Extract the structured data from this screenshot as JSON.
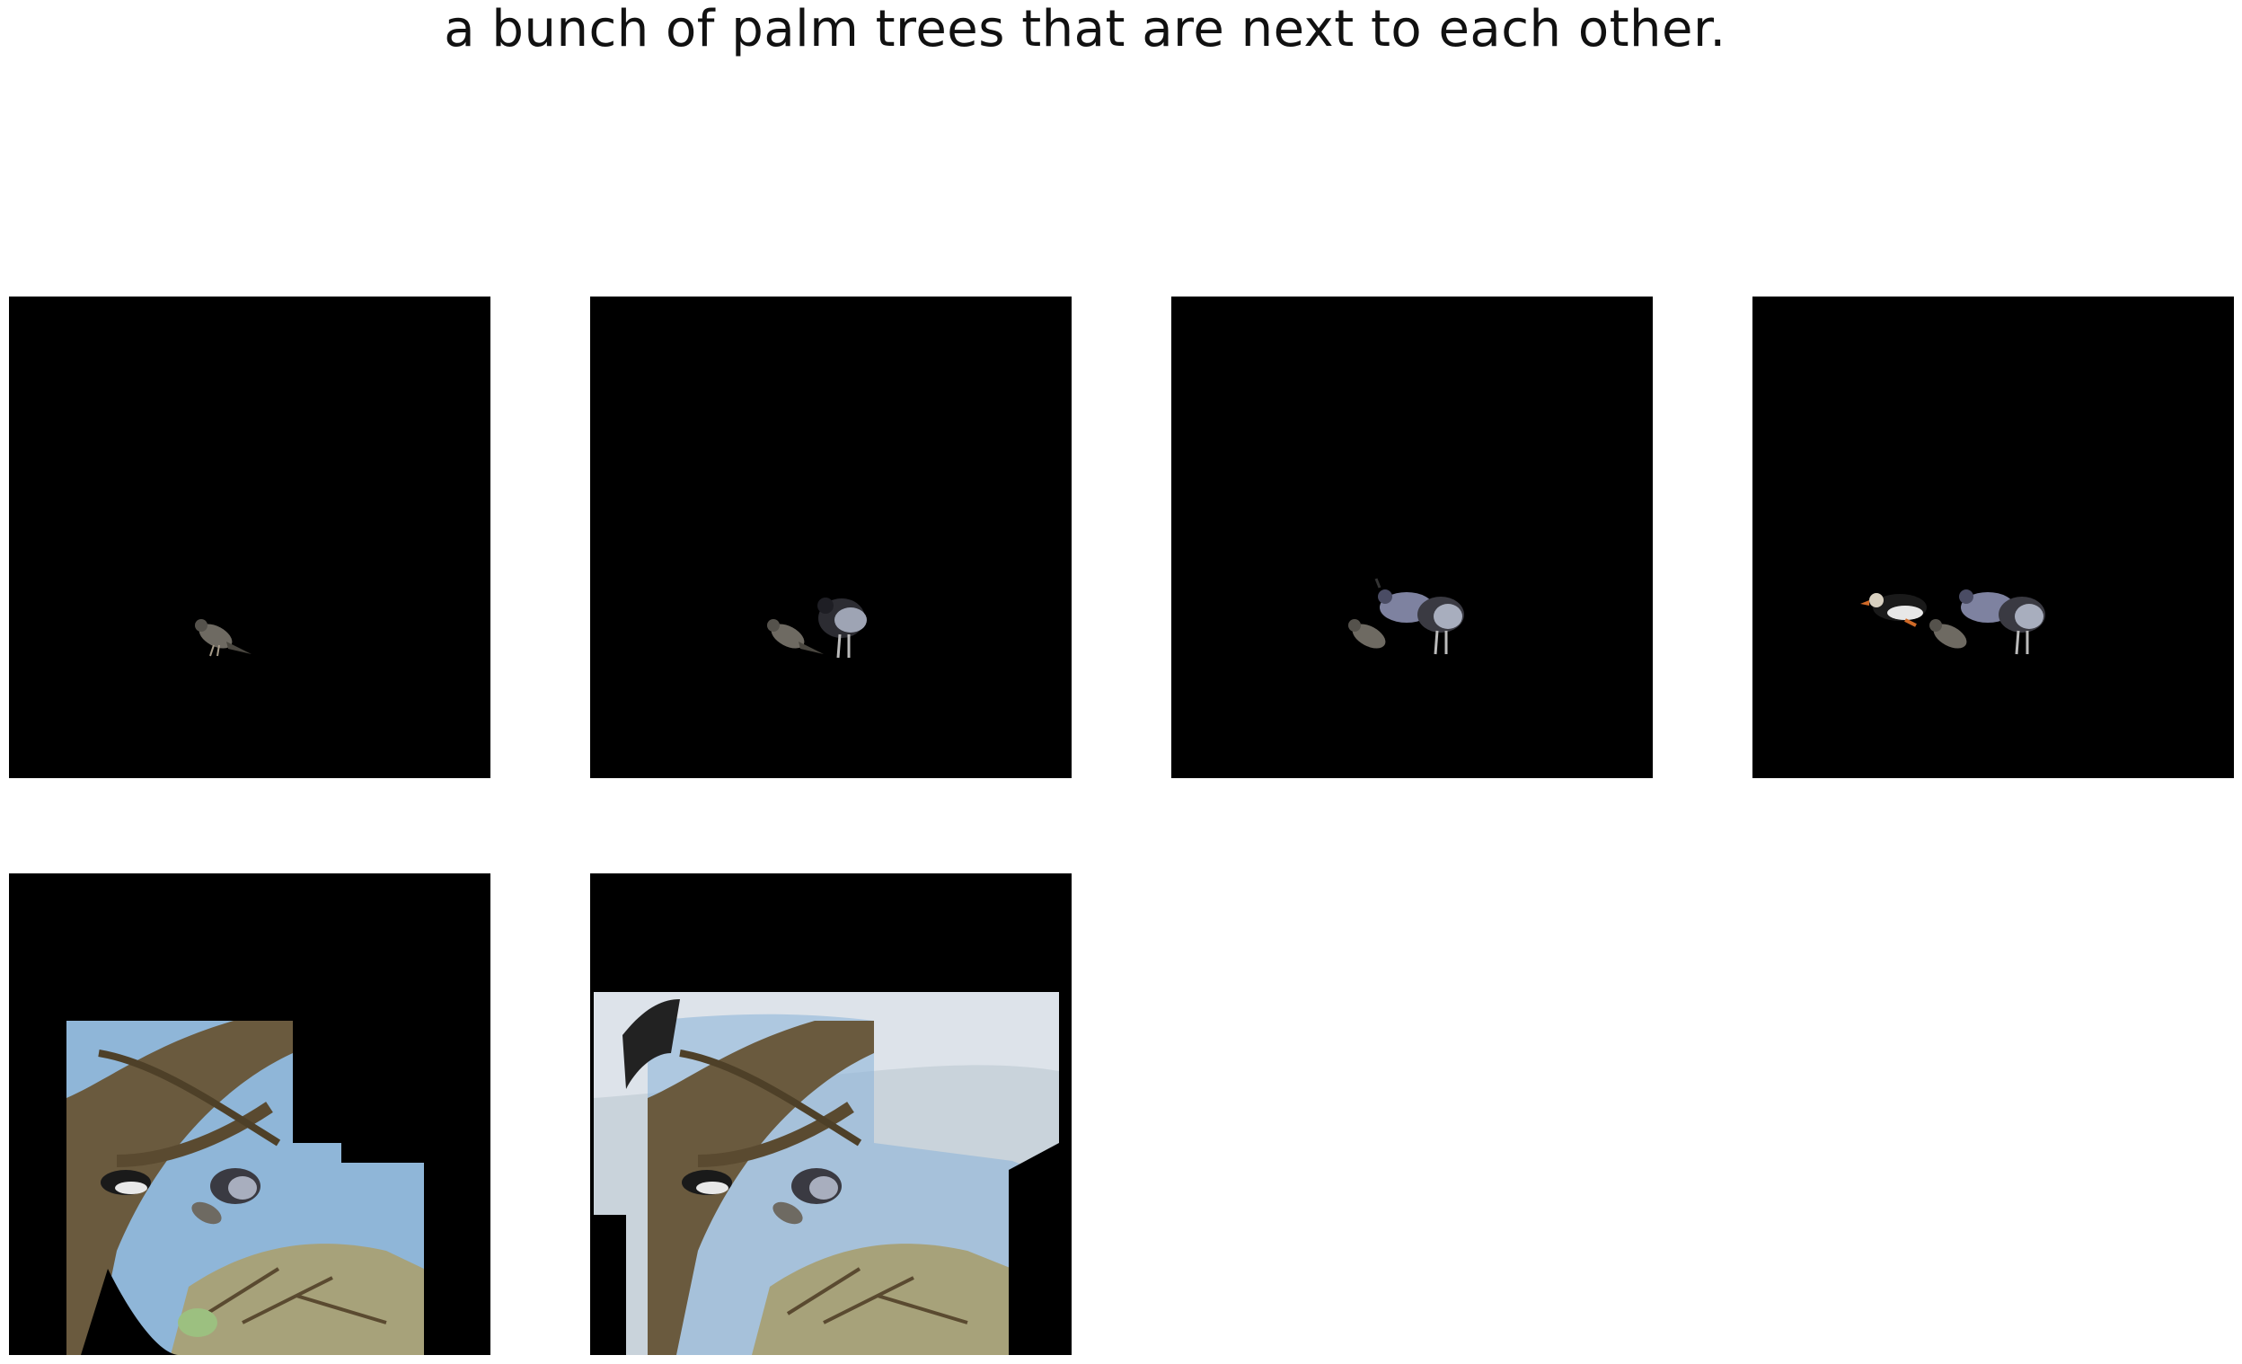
{
  "caption": "a bunch of palm trees that are next to each other.",
  "panels": [
    {
      "step": 1,
      "content": [
        "sparrow"
      ]
    },
    {
      "step": 2,
      "content": [
        "sparrow",
        "dark pigeon"
      ]
    },
    {
      "step": 3,
      "content": [
        "sparrow",
        "pigeons"
      ]
    },
    {
      "step": 4,
      "content": [
        "puffin",
        "sparrow",
        "pigeons"
      ]
    },
    {
      "step": 5,
      "content": [
        "bare tree branches",
        "birds",
        "blue sky patches"
      ]
    },
    {
      "step": 6,
      "content": [
        "cloudy sky",
        "bare tree branches",
        "birds"
      ]
    }
  ],
  "colors": {
    "background": "#ffffff",
    "panel_fill": "#000000",
    "caption_text": "#111111"
  }
}
